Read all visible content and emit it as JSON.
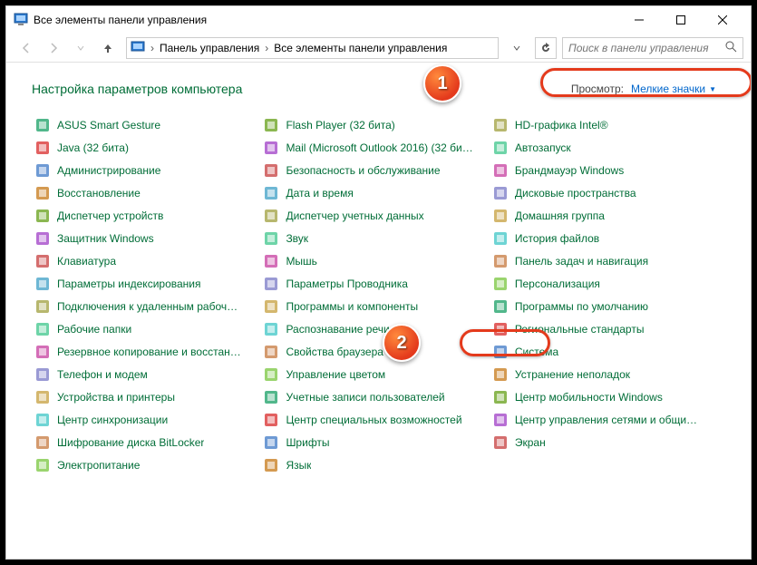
{
  "window": {
    "title": "Все элементы панели управления"
  },
  "breadcrumb": {
    "root": "Панель управления",
    "current": "Все элементы панели управления"
  },
  "search": {
    "placeholder": "Поиск в панели управления"
  },
  "header": {
    "title": "Настройка параметров компьютера"
  },
  "view": {
    "label": "Просмотр:",
    "value": "Мелкие значки"
  },
  "cols": [
    [
      "ASUS Smart Gesture",
      "Java (32 бита)",
      "Администрирование",
      "Восстановление",
      "Диспетчер устройств",
      "Защитник Windows",
      "Клавиатура",
      "Параметры индексирования",
      "Подключения к удаленным рабоч…",
      "Рабочие папки",
      "Резервное копирование и восстан…",
      "Телефон и модем",
      "Устройства и принтеры",
      "Центр синхронизации",
      "Шифрование диска BitLocker",
      "Электропитание"
    ],
    [
      "Flash Player (32 бита)",
      "Mail (Microsoft Outlook 2016) (32 би…",
      "Безопасность и обслуживание",
      "Дата и время",
      "Диспетчер учетных данных",
      "Звук",
      "Мышь",
      "Параметры Проводника",
      "Программы и компоненты",
      "Распознавание речи",
      "Свойства браузера",
      "Управление цветом",
      "Учетные записи пользователей",
      "Центр специальных возможностей",
      "Шрифты",
      "Язык"
    ],
    [
      "HD-графика Intel®",
      "Автозапуск",
      "Брандмауэр Windows",
      "Дисковые пространства",
      "Домашняя группа",
      "История файлов",
      "Панель задач и навигация",
      "Персонализация",
      "Программы по умолчанию",
      "Региональные стандарты",
      "Система",
      "Устранение неполадок",
      "Центр мобильности Windows",
      "Центр управления сетями и общи…",
      "Экран"
    ]
  ],
  "badges": {
    "b1": "1",
    "b2": "2"
  }
}
